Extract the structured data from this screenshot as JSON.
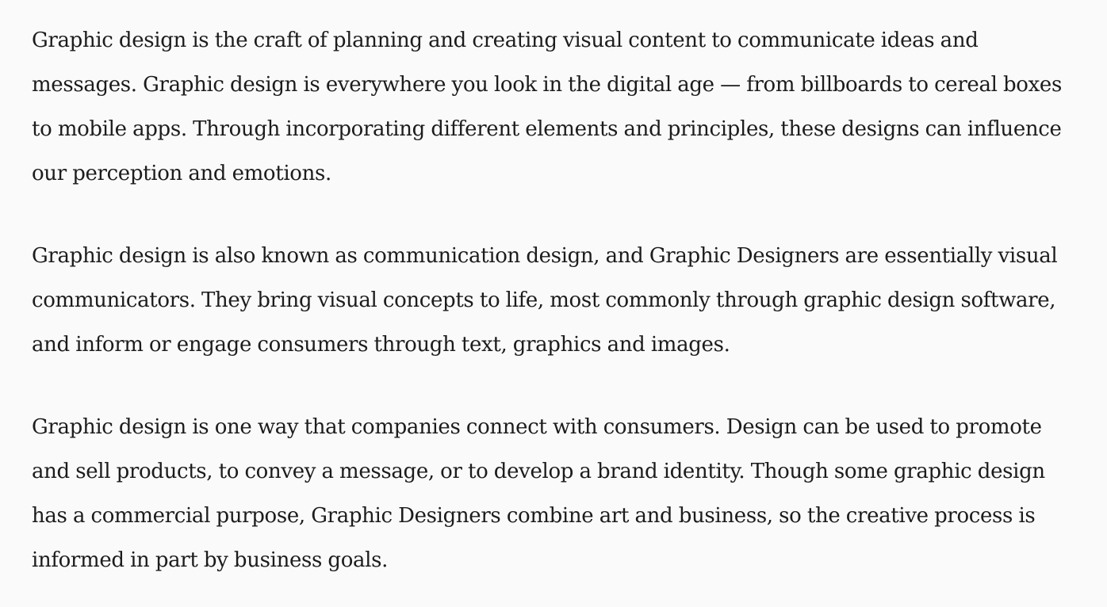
{
  "article": {
    "paragraphs": [
      "Graphic design is the craft of planning and creating visual content to communicate ideas and messages. Graphic design is everywhere you look in the digital age — from billboards to cereal boxes to mobile apps. Through incorporating different elements and principles, these designs can influence our perception and emotions.",
      "Graphic design is also known as communication design, and Graphic Designers are essentially visual communicators. They bring visual concepts to life, most commonly through graphic design software, and inform or engage consumers through text, graphics and images.",
      "Graphic design is one way that companies connect with consumers. Design can be used to promote and sell products, to convey a message, or to develop a brand identity. Though some graphic design has a commercial purpose, Graphic Designers combine art and business, so the creative process is informed in part by business goals."
    ]
  }
}
